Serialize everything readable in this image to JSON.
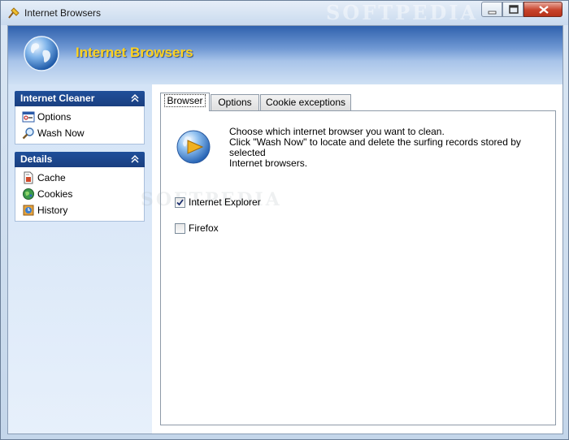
{
  "window": {
    "title": "Internet Browsers",
    "watermark": "SOFTPEDIA"
  },
  "banner": {
    "title": "Internet Browsers"
  },
  "sidebar": {
    "panels": [
      {
        "title": "Internet Cleaner",
        "items": [
          {
            "label": "Options",
            "icon": "options-icon"
          },
          {
            "label": "Wash Now",
            "icon": "wash-now-icon"
          }
        ]
      },
      {
        "title": "Details",
        "items": [
          {
            "label": "Cache",
            "icon": "cache-icon"
          },
          {
            "label": "Cookies",
            "icon": "cookies-icon"
          },
          {
            "label": "History",
            "icon": "history-icon"
          }
        ]
      }
    ]
  },
  "tabs": [
    {
      "label": "Browser",
      "active": true
    },
    {
      "label": "Options",
      "active": false
    },
    {
      "label": "Cookie exceptions",
      "active": false
    }
  ],
  "browser_tab": {
    "description_lines": [
      "Choose which internet browser you want to clean.",
      "Click \"Wash Now\" to locate and delete the surfing records stored by selected",
      "Internet browsers."
    ],
    "browsers": [
      {
        "label": "Internet Explorer",
        "checked": true
      },
      {
        "label": "Firefox",
        "checked": false
      }
    ]
  },
  "colors": {
    "banner_title": "#ffd21f",
    "panel_header": "#1f4f9a",
    "close_button": "#c7432b"
  }
}
